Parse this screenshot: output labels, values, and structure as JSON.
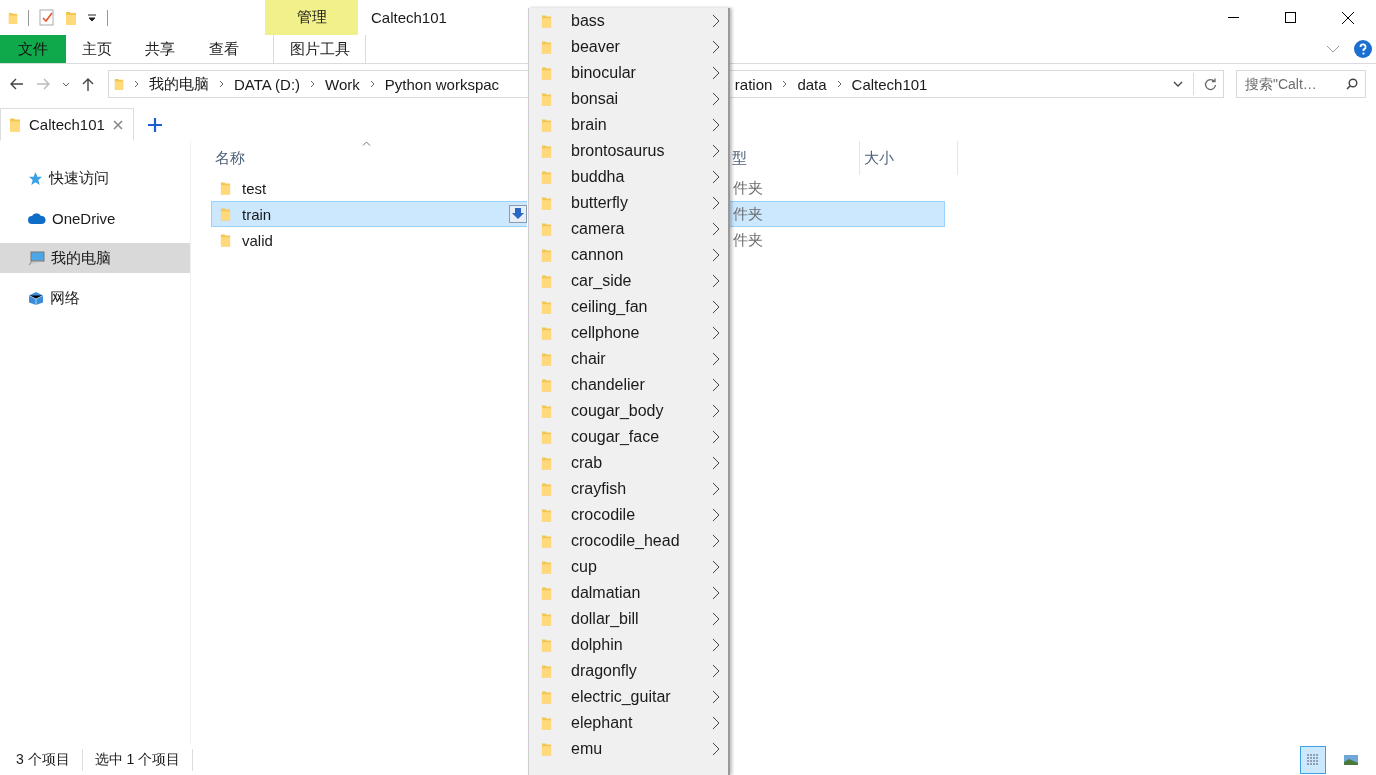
{
  "window": {
    "title": "Caltech101",
    "context_group": "管理"
  },
  "ribbon_tabs": [
    {
      "label": "文件",
      "kind": "file"
    },
    {
      "label": "主页",
      "kind": "normal"
    },
    {
      "label": "共享",
      "kind": "normal"
    },
    {
      "label": "查看",
      "kind": "normal"
    },
    {
      "label": "图片工具",
      "kind": "context"
    }
  ],
  "address_bar": {
    "segments": [
      "我的电脑",
      "DATA (D:)",
      "Work",
      "Python workspac",
      "ration",
      "data",
      "Caltech101"
    ]
  },
  "search": {
    "placeholder": "搜索\"Calt…"
  },
  "doc_tabs": [
    {
      "label": "Caltech101",
      "selected": true
    }
  ],
  "sidebar": {
    "items": [
      {
        "label": "快速访问",
        "kind": "star",
        "selected": false
      },
      {
        "label": "OneDrive",
        "kind": "cloud",
        "selected": false
      },
      {
        "label": "我的电脑",
        "kind": "pc",
        "selected": true
      },
      {
        "label": "网络",
        "kind": "network",
        "selected": false
      }
    ]
  },
  "columns": [
    "名称",
    "型",
    "大小"
  ],
  "rows": [
    {
      "name": "test",
      "type": "件夹",
      "selected": false
    },
    {
      "name": "train",
      "type": "件夹",
      "selected": true
    },
    {
      "name": "valid",
      "type": "件夹",
      "selected": false
    }
  ],
  "menu": {
    "items": [
      "bass",
      "beaver",
      "binocular",
      "bonsai",
      "brain",
      "brontosaurus",
      "buddha",
      "butterfly",
      "camera",
      "cannon",
      "car_side",
      "ceiling_fan",
      "cellphone",
      "chair",
      "chandelier",
      "cougar_body",
      "cougar_face",
      "crab",
      "crayfish",
      "crocodile",
      "crocodile_head",
      "cup",
      "dalmatian",
      "dollar_bill",
      "dolphin",
      "dragonfly",
      "electric_guitar",
      "elephant",
      "emu"
    ]
  },
  "status_bar": {
    "count": "3 个项目",
    "selection": "选中 1 个项目"
  },
  "view_buttons": [
    {
      "kind": "details",
      "selected": true
    },
    {
      "kind": "tiles",
      "selected": false
    }
  ]
}
